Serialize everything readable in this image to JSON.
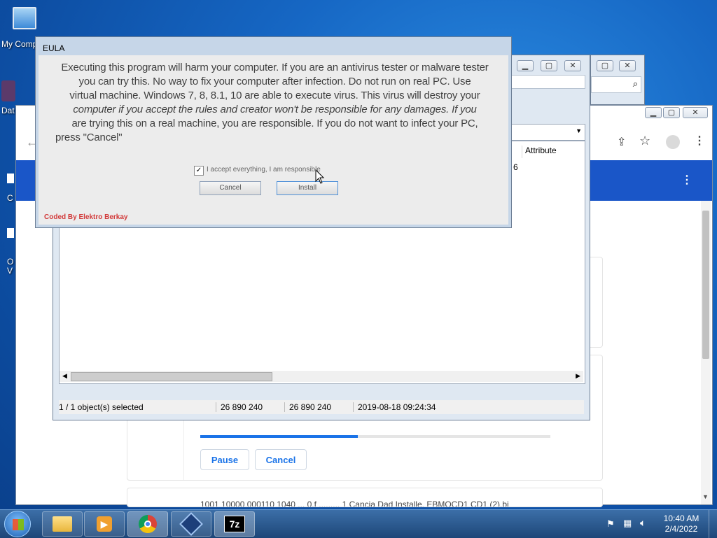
{
  "desktop": {
    "icons": [
      {
        "label": "My Comp"
      },
      {
        "label": "Dat"
      },
      {
        "label": "C"
      },
      {
        "label": "O\nV"
      }
    ]
  },
  "eula": {
    "title": "EULA",
    "text_line1": "Executing this program will harm your computer. If you are an antivirus tester or malware tester",
    "text_line2": "you can try this. No way to fix your computer after infection. Do not run on real PC. Use",
    "text_line3": "virtual machine. Windows 7, 8, 8.1, 10 are able to execute virus. This virus will destroy your",
    "text_line4": "computer if you accept the rules and creator won't be responsible for any damages. If you",
    "text_line5": "are trying this on a real machine, you are responsible. If you do not want to infect your PC,",
    "text_line6": "press \"Cancel\"",
    "checkbox_label": "I accept everything, I am responsible",
    "cancel_label": "Cancel",
    "install_label": "Install",
    "credit": "Coded By Elektro Berkay",
    "credit_color": "#d23a3a"
  },
  "zip": {
    "column_attributes": "Attribute",
    "row_partial": "6",
    "status": {
      "selected": "1 / 1 object(s) selected",
      "size": "26 890 240",
      "packed": "26 890 240",
      "modified": "2019-08-18 09:24:34"
    }
  },
  "chrome": {
    "download": {
      "progress_percent": 45,
      "pause_label": "Pause",
      "cancel_label": "Cancel",
      "next_item_text": "1001 10000 000110 1040 ... 0.f ......... 1 Cancia Dad Installe. EBMOCD1 CD1 (2).bi"
    }
  },
  "taskbar": {
    "clock_time": "10:40 AM",
    "clock_date": "2/4/2022"
  },
  "colors": {
    "chrome_band": "#1a56c8",
    "progress": "#1a73e8"
  }
}
